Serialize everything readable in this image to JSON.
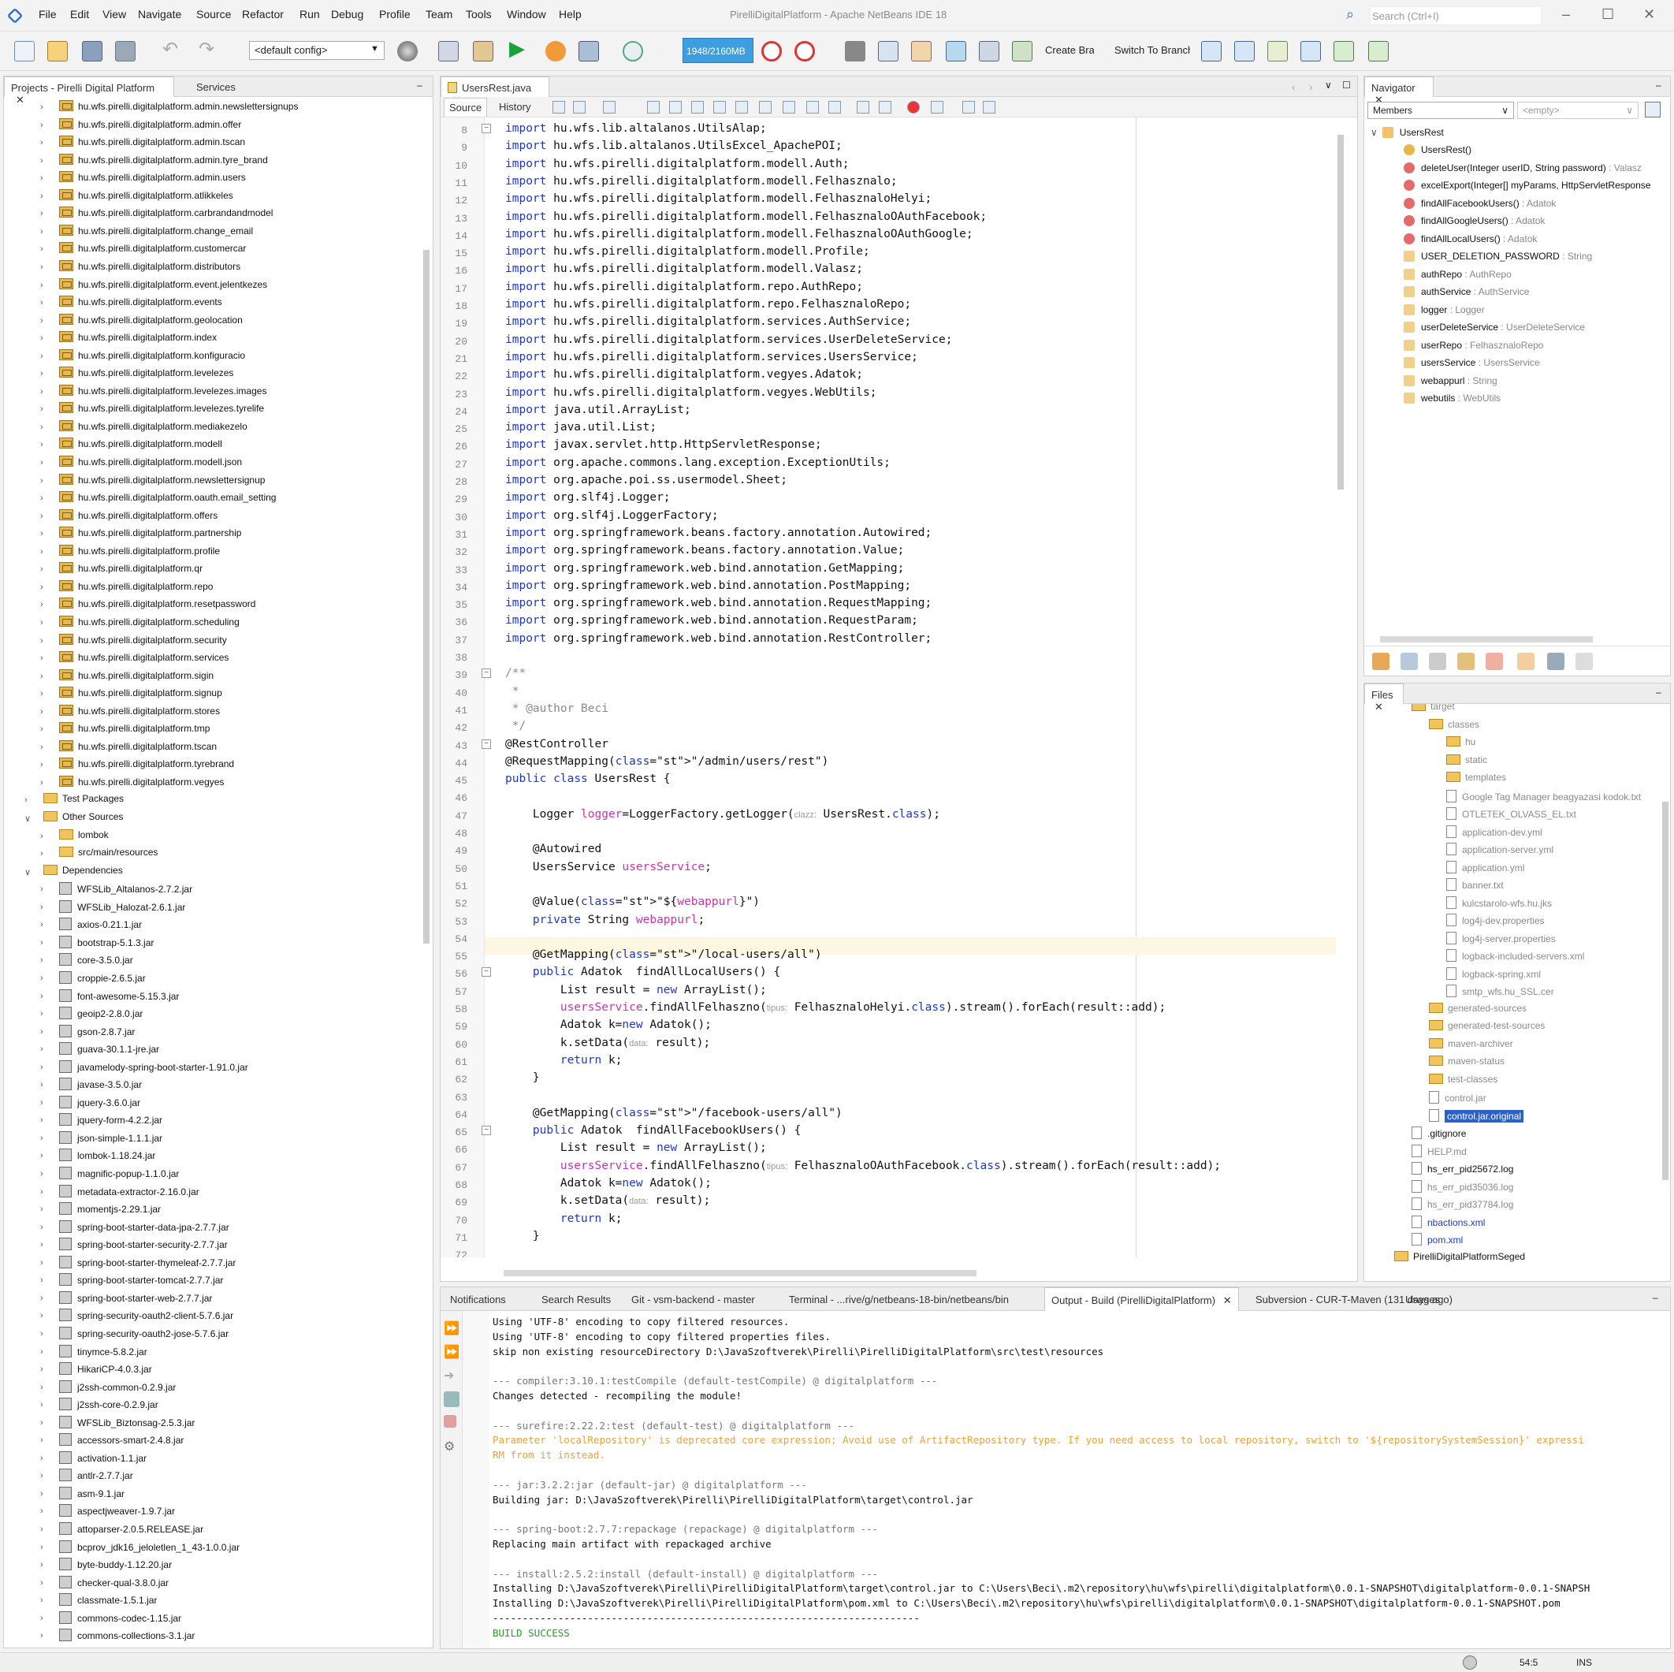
{
  "window": {
    "title": "PirelliDigitalPlatform - Apache NetBeans IDE 18",
    "search_placeholder": "Search (Ctrl+I)"
  },
  "menu": [
    "File",
    "Edit",
    "View",
    "Navigate",
    "Source",
    "Refactor",
    "Run",
    "Debug",
    "Profile",
    "Team",
    "Tools",
    "Window",
    "Help"
  ],
  "toolbar": {
    "config": "<default config>",
    "memory": "1948/2160MB",
    "create_branch": "Create Branch",
    "switch_branch": "Switch To Branch"
  },
  "projects_panel": {
    "tabs": [
      "Projects - Pirelli Digital Platform",
      "Services"
    ],
    "packages": [
      "hu.wfs.pirelli.digitalplatform.admin.newslettersignups",
      "hu.wfs.pirelli.digitalplatform.admin.offer",
      "hu.wfs.pirelli.digitalplatform.admin.tscan",
      "hu.wfs.pirelli.digitalplatform.admin.tyre_brand",
      "hu.wfs.pirelli.digitalplatform.admin.users",
      "hu.wfs.pirelli.digitalplatform.atlikkeles",
      "hu.wfs.pirelli.digitalplatform.carbrandandmodel",
      "hu.wfs.pirelli.digitalplatform.change_email",
      "hu.wfs.pirelli.digitalplatform.customercar",
      "hu.wfs.pirelli.digitalplatform.distributors",
      "hu.wfs.pirelli.digitalplatform.event.jelentkezes",
      "hu.wfs.pirelli.digitalplatform.events",
      "hu.wfs.pirelli.digitalplatform.geolocation",
      "hu.wfs.pirelli.digitalplatform.index",
      "hu.wfs.pirelli.digitalplatform.konfiguracio",
      "hu.wfs.pirelli.digitalplatform.levelezes",
      "hu.wfs.pirelli.digitalplatform.levelezes.images",
      "hu.wfs.pirelli.digitalplatform.levelezes.tyrelife",
      "hu.wfs.pirelli.digitalplatform.mediakezelo",
      "hu.wfs.pirelli.digitalplatform.modell",
      "hu.wfs.pirelli.digitalplatform.modell.json",
      "hu.wfs.pirelli.digitalplatform.newslettersignup",
      "hu.wfs.pirelli.digitalplatform.oauth.email_setting",
      "hu.wfs.pirelli.digitalplatform.offers",
      "hu.wfs.pirelli.digitalplatform.partnership",
      "hu.wfs.pirelli.digitalplatform.profile",
      "hu.wfs.pirelli.digitalplatform.qr",
      "hu.wfs.pirelli.digitalplatform.repo",
      "hu.wfs.pirelli.digitalplatform.resetpassword",
      "hu.wfs.pirelli.digitalplatform.scheduling",
      "hu.wfs.pirelli.digitalplatform.security",
      "hu.wfs.pirelli.digitalplatform.services",
      "hu.wfs.pirelli.digitalplatform.sigin",
      "hu.wfs.pirelli.digitalplatform.signup",
      "hu.wfs.pirelli.digitalplatform.stores",
      "hu.wfs.pirelli.digitalplatform.tmp",
      "hu.wfs.pirelli.digitalplatform.tscan",
      "hu.wfs.pirelli.digitalplatform.tyrebrand",
      "hu.wfs.pirelli.digitalplatform.vegyes"
    ],
    "test_packages": "Test Packages",
    "other_sources": "Other Sources",
    "other_children": [
      "lombok",
      "src/main/resources"
    ],
    "dependencies": "Dependencies",
    "jars": [
      "WFSLib_Altalanos-2.7.2.jar",
      "WFSLib_Halozat-2.6.1.jar",
      "axios-0.21.1.jar",
      "bootstrap-5.1.3.jar",
      "core-3.5.0.jar",
      "croppie-2.6.5.jar",
      "font-awesome-5.15.3.jar",
      "geoip2-2.8.0.jar",
      "gson-2.8.7.jar",
      "guava-30.1.1-jre.jar",
      "javamelody-spring-boot-starter-1.91.0.jar",
      "javase-3.5.0.jar",
      "jquery-3.6.0.jar",
      "jquery-form-4.2.2.jar",
      "json-simple-1.1.1.jar",
      "lombok-1.18.24.jar",
      "magnific-popup-1.1.0.jar",
      "metadata-extractor-2.16.0.jar",
      "momentjs-2.29.1.jar",
      "spring-boot-starter-data-jpa-2.7.7.jar",
      "spring-boot-starter-security-2.7.7.jar",
      "spring-boot-starter-thymeleaf-2.7.7.jar",
      "spring-boot-starter-tomcat-2.7.7.jar",
      "spring-boot-starter-web-2.7.7.jar",
      "spring-security-oauth2-client-5.7.6.jar",
      "spring-security-oauth2-jose-5.7.6.jar",
      "tinymce-5.8.2.jar",
      "HikariCP-4.0.3.jar",
      "j2ssh-common-0.2.9.jar",
      "j2ssh-core-0.2.9.jar",
      "WFSLib_Biztonsag-2.5.3.jar",
      "accessors-smart-2.4.8.jar",
      "activation-1.1.jar",
      "antlr-2.7.7.jar",
      "asm-9.1.jar",
      "aspectjweaver-1.9.7.jar",
      "attoparser-2.0.5.RELEASE.jar",
      "bcprov_jdk16_jeloletlen_1_43-1.0.0.jar",
      "byte-buddy-1.12.20.jar",
      "checker-qual-3.8.0.jar",
      "classmate-1.5.1.jar",
      "commons-codec-1.15.jar",
      "commons-collections-3.1.jar"
    ]
  },
  "editor": {
    "file_tab": "UsersRest.java",
    "subtabs": [
      "Source",
      "History"
    ],
    "lines": [
      {
        "n": "8",
        "t": "import hu.wfs.lib.altalanos.UtilsAlap;"
      },
      {
        "n": "9",
        "t": "import hu.wfs.lib.altalanos.UtilsExcel_ApachePOI;"
      },
      {
        "n": "10",
        "t": "import hu.wfs.pirelli.digitalplatform.modell.Auth;"
      },
      {
        "n": "11",
        "t": "import hu.wfs.pirelli.digitalplatform.modell.Felhasznalo;"
      },
      {
        "n": "12",
        "t": "import hu.wfs.pirelli.digitalplatform.modell.FelhasznaloHelyi;"
      },
      {
        "n": "13",
        "t": "import hu.wfs.pirelli.digitalplatform.modell.FelhasznaloOAuthFacebook;"
      },
      {
        "n": "14",
        "t": "import hu.wfs.pirelli.digitalplatform.modell.FelhasznaloOAuthGoogle;"
      },
      {
        "n": "15",
        "t": "import hu.wfs.pirelli.digitalplatform.modell.Profile;"
      },
      {
        "n": "16",
        "t": "import hu.wfs.pirelli.digitalplatform.modell.Valasz;"
      },
      {
        "n": "17",
        "t": "import hu.wfs.pirelli.digitalplatform.repo.AuthRepo;"
      },
      {
        "n": "18",
        "t": "import hu.wfs.pirelli.digitalplatform.repo.FelhasznaloRepo;"
      },
      {
        "n": "19",
        "t": "import hu.wfs.pirelli.digitalplatform.services.AuthService;"
      },
      {
        "n": "20",
        "t": "import hu.wfs.pirelli.digitalplatform.services.UserDeleteService;"
      },
      {
        "n": "21",
        "t": "import hu.wfs.pirelli.digitalplatform.services.UsersService;"
      },
      {
        "n": "22",
        "t": "import hu.wfs.pirelli.digitalplatform.vegyes.Adatok;"
      },
      {
        "n": "23",
        "t": "import hu.wfs.pirelli.digitalplatform.vegyes.WebUtils;"
      },
      {
        "n": "24",
        "t": "import java.util.ArrayList;"
      },
      {
        "n": "25",
        "t": "import java.util.List;"
      },
      {
        "n": "26",
        "t": "import javax.servlet.http.HttpServletResponse;"
      },
      {
        "n": "27",
        "t": "import org.apache.commons.lang.exception.ExceptionUtils;"
      },
      {
        "n": "28",
        "t": "import org.apache.poi.ss.usermodel.Sheet;"
      },
      {
        "n": "29",
        "t": "import org.slf4j.Logger;"
      },
      {
        "n": "30",
        "t": "import org.slf4j.LoggerFactory;"
      },
      {
        "n": "31",
        "t": "import org.springframework.beans.factory.annotation.Autowired;"
      },
      {
        "n": "32",
        "t": "import org.springframework.beans.factory.annotation.Value;"
      },
      {
        "n": "33",
        "t": "import org.springframework.web.bind.annotation.GetMapping;"
      },
      {
        "n": "34",
        "t": "import org.springframework.web.bind.annotation.PostMapping;"
      },
      {
        "n": "35",
        "t": "import org.springframework.web.bind.annotation.RequestMapping;"
      },
      {
        "n": "36",
        "t": "import org.springframework.web.bind.annotation.RequestParam;"
      },
      {
        "n": "37",
        "t": "import org.springframework.web.bind.annotation.RestController;"
      },
      {
        "n": "38",
        "t": ""
      },
      {
        "n": "39",
        "t": "/**"
      },
      {
        "n": "40",
        "t": " *"
      },
      {
        "n": "41",
        "t": " * @author Beci"
      },
      {
        "n": "42",
        "t": " */"
      },
      {
        "n": "43",
        "t": "@RestController"
      },
      {
        "n": "44",
        "t": "@RequestMapping(\"/admin/users/rest\")"
      },
      {
        "n": "45",
        "t": "public class UsersRest {"
      },
      {
        "n": "46",
        "t": ""
      },
      {
        "n": "47",
        "t": "    Logger logger=LoggerFactory.getLogger(clazz: UsersRest.class);"
      },
      {
        "n": "48",
        "t": ""
      },
      {
        "n": "49",
        "t": "    @Autowired"
      },
      {
        "n": "50",
        "t": "    UsersService usersService;"
      },
      {
        "n": "51",
        "t": ""
      },
      {
        "n": "52",
        "t": "    @Value(\"${webappurl}\")"
      },
      {
        "n": "53",
        "t": "    private String webappurl;"
      },
      {
        "n": "54",
        "t": ""
      },
      {
        "n": "55",
        "t": "    @GetMapping(\"/local-users/all\")"
      },
      {
        "n": "56",
        "t": "    public Adatok  findAllLocalUsers() {"
      },
      {
        "n": "57",
        "t": "        List result = new ArrayList();"
      },
      {
        "n": "58",
        "t": "        usersService.findAllFelhaszno(tipus: FelhasznaloHelyi.class).stream().forEach(result::add);"
      },
      {
        "n": "59",
        "t": "        Adatok k=new Adatok();"
      },
      {
        "n": "60",
        "t": "        k.setData(data: result);"
      },
      {
        "n": "61",
        "t": "        return k;"
      },
      {
        "n": "62",
        "t": "    }"
      },
      {
        "n": "63",
        "t": ""
      },
      {
        "n": "64",
        "t": "    @GetMapping(\"/facebook-users/all\")"
      },
      {
        "n": "65",
        "t": "    public Adatok  findAllFacebookUsers() {"
      },
      {
        "n": "66",
        "t": "        List result = new ArrayList();"
      },
      {
        "n": "67",
        "t": "        usersService.findAllFelhaszno(tipus: FelhasznaloOAuthFacebook.class).stream().forEach(result::add);"
      },
      {
        "n": "68",
        "t": "        Adatok k=new Adatok();"
      },
      {
        "n": "69",
        "t": "        k.setData(data: result);"
      },
      {
        "n": "70",
        "t": "        return k;"
      },
      {
        "n": "71",
        "t": "    }"
      },
      {
        "n": "72",
        "t": ""
      }
    ]
  },
  "navigator": {
    "tab": "Navigator",
    "filter": "Members",
    "filter2": "<empty>",
    "class_name": "UsersRest",
    "members": [
      {
        "name": "UsersRest()",
        "type": ""
      },
      {
        "name": "deleteUser(Integer userID, String password)",
        "type": " : Valasz"
      },
      {
        "name": "excelExport(Integer[] myParams, HttpServletResponse",
        "type": ""
      },
      {
        "name": "findAllFacebookUsers()",
        "type": " : Adatok"
      },
      {
        "name": "findAllGoogleUsers()",
        "type": " : Adatok"
      },
      {
        "name": "findAllLocalUsers()",
        "type": " : Adatok"
      },
      {
        "name": "USER_DELETION_PASSWORD",
        "type": " : String"
      },
      {
        "name": "authRepo",
        "type": " : AuthRepo"
      },
      {
        "name": "authService",
        "type": " : AuthService"
      },
      {
        "name": "logger",
        "type": " : Logger"
      },
      {
        "name": "userDeleteService",
        "type": " : UserDeleteService"
      },
      {
        "name": "userRepo",
        "type": " : FelhasznaloRepo"
      },
      {
        "name": "usersService",
        "type": " : UsersService"
      },
      {
        "name": "webappurl",
        "type": " : String"
      },
      {
        "name": "webutils",
        "type": " : WebUtils"
      }
    ]
  },
  "files": {
    "tab": "Files",
    "items": [
      {
        "label": "target",
        "indent": 0,
        "kind": "folder"
      },
      {
        "label": "classes",
        "indent": 1,
        "kind": "folder"
      },
      {
        "label": "hu",
        "indent": 2,
        "kind": "folder"
      },
      {
        "label": "static",
        "indent": 2,
        "kind": "folder"
      },
      {
        "label": "templates",
        "indent": 2,
        "kind": "folder"
      },
      {
        "label": "Google Tag Manager beagyazasi kodok.txt",
        "indent": 2,
        "kind": "file"
      },
      {
        "label": "OTLETEK_OLVASS_EL.txt",
        "indent": 2,
        "kind": "file"
      },
      {
        "label": "application-dev.yml",
        "indent": 2,
        "kind": "file"
      },
      {
        "label": "application-server.yml",
        "indent": 2,
        "kind": "file"
      },
      {
        "label": "application.yml",
        "indent": 2,
        "kind": "file"
      },
      {
        "label": "banner.txt",
        "indent": 2,
        "kind": "file"
      },
      {
        "label": "kulcstarolo-wfs.hu.jks",
        "indent": 2,
        "kind": "file"
      },
      {
        "label": "log4j-dev.properties",
        "indent": 2,
        "kind": "file"
      },
      {
        "label": "log4j-server.properties",
        "indent": 2,
        "kind": "file"
      },
      {
        "label": "logback-included-servers.xml",
        "indent": 2,
        "kind": "file"
      },
      {
        "label": "logback-spring.xml",
        "indent": 2,
        "kind": "file"
      },
      {
        "label": "smtp_wfs.hu_SSL.cer",
        "indent": 2,
        "kind": "file"
      },
      {
        "label": "generated-sources",
        "indent": 1,
        "kind": "folder"
      },
      {
        "label": "generated-test-sources",
        "indent": 1,
        "kind": "folder"
      },
      {
        "label": "maven-archiver",
        "indent": 1,
        "kind": "folder"
      },
      {
        "label": "maven-status",
        "indent": 1,
        "kind": "folder"
      },
      {
        "label": "test-classes",
        "indent": 1,
        "kind": "folder"
      },
      {
        "label": "control.jar",
        "indent": 1,
        "kind": "file"
      },
      {
        "label": "control.jar.original",
        "indent": 1,
        "kind": "file"
      },
      {
        "label": ".gitignore",
        "indent": 0,
        "kind": "file"
      },
      {
        "label": "HELP.md",
        "indent": 0,
        "kind": "file"
      },
      {
        "label": "hs_err_pid25672.log",
        "indent": 0,
        "kind": "file"
      },
      {
        "label": "hs_err_pid35036.log",
        "indent": 0,
        "kind": "file"
      },
      {
        "label": "hs_err_pid37784.log",
        "indent": 0,
        "kind": "file"
      },
      {
        "label": "nbactions.xml",
        "indent": 0,
        "kind": "file"
      },
      {
        "label": "pom.xml",
        "indent": 0,
        "kind": "file"
      },
      {
        "label": "PirelliDigitalPlatformSeged",
        "indent": -1,
        "kind": "project"
      }
    ]
  },
  "output": {
    "tabs": [
      "Notifications",
      "Search Results",
      "Git - vsm-backend - master",
      "Terminal - ...rive/g/netbeans-18-bin/netbeans/bin",
      "Output - Build (PirelliDigitalPlatform)",
      "Subversion - CUR-T-Maven (131 days ago)",
      "Usages"
    ],
    "lines": [
      {
        "t": "Using 'UTF-8' encoding to copy filtered resources.",
        "c": ""
      },
      {
        "t": "Using 'UTF-8' encoding to copy filtered properties files.",
        "c": ""
      },
      {
        "t": "skip non existing resourceDirectory D:\\JavaSzoftverek\\Pirelli\\PirelliDigitalPlatform\\src\\test\\resources",
        "c": ""
      },
      {
        "t": "",
        "c": ""
      },
      {
        "t": "--- compiler:3.10.1:testCompile (default-testCompile) @ digitalplatform ---",
        "c": "g"
      },
      {
        "t": "Changes detected - recompiling the module!",
        "c": ""
      },
      {
        "t": "",
        "c": ""
      },
      {
        "t": "--- surefire:2.22.2:test (default-test) @ digitalplatform ---",
        "c": "g"
      },
      {
        "t": "Parameter 'localRepository' is deprecated core expression; Avoid use of ArtifactRepository type. If you need access to local repository, switch to '${repositorySystemSession}' expressi",
        "c": "w"
      },
      {
        "t": "RM from it instead.",
        "c": "w"
      },
      {
        "t": "",
        "c": ""
      },
      {
        "t": "--- jar:3.2.2:jar (default-jar) @ digitalplatform ---",
        "c": "g"
      },
      {
        "t": "Building jar: D:\\JavaSzoftverek\\Pirelli\\PirelliDigitalPlatform\\target\\control.jar",
        "c": ""
      },
      {
        "t": "",
        "c": ""
      },
      {
        "t": "--- spring-boot:2.7.7:repackage (repackage) @ digitalplatform ---",
        "c": "g"
      },
      {
        "t": "Replacing main artifact with repackaged archive",
        "c": ""
      },
      {
        "t": "",
        "c": ""
      },
      {
        "t": "--- install:2.5.2:install (default-install) @ digitalplatform ---",
        "c": "g"
      },
      {
        "t": "Installing D:\\JavaSzoftverek\\Pirelli\\PirelliDigitalPlatform\\target\\control.jar to C:\\Users\\Beci\\.m2\\repository\\hu\\wfs\\pirelli\\digitalplatform\\0.0.1-SNAPSHOT\\digitalplatform-0.0.1-SNAPSH",
        "c": ""
      },
      {
        "t": "Installing D:\\JavaSzoftverek\\Pirelli\\PirelliDigitalPlatform\\pom.xml to C:\\Users\\Beci\\.m2\\repository\\hu\\wfs\\pirelli\\digitalplatform\\0.0.1-SNAPSHOT\\digitalplatform-0.0.1-SNAPSHOT.pom",
        "c": ""
      },
      {
        "t": "------------------------------------------------------------------------",
        "c": ""
      },
      {
        "t": "BUILD SUCCESS",
        "c": "s"
      },
      {
        "t": "------------------------------------------------------------------------",
        "c": ""
      }
    ]
  },
  "status": {
    "position": "54:5",
    "mode": "INS"
  }
}
